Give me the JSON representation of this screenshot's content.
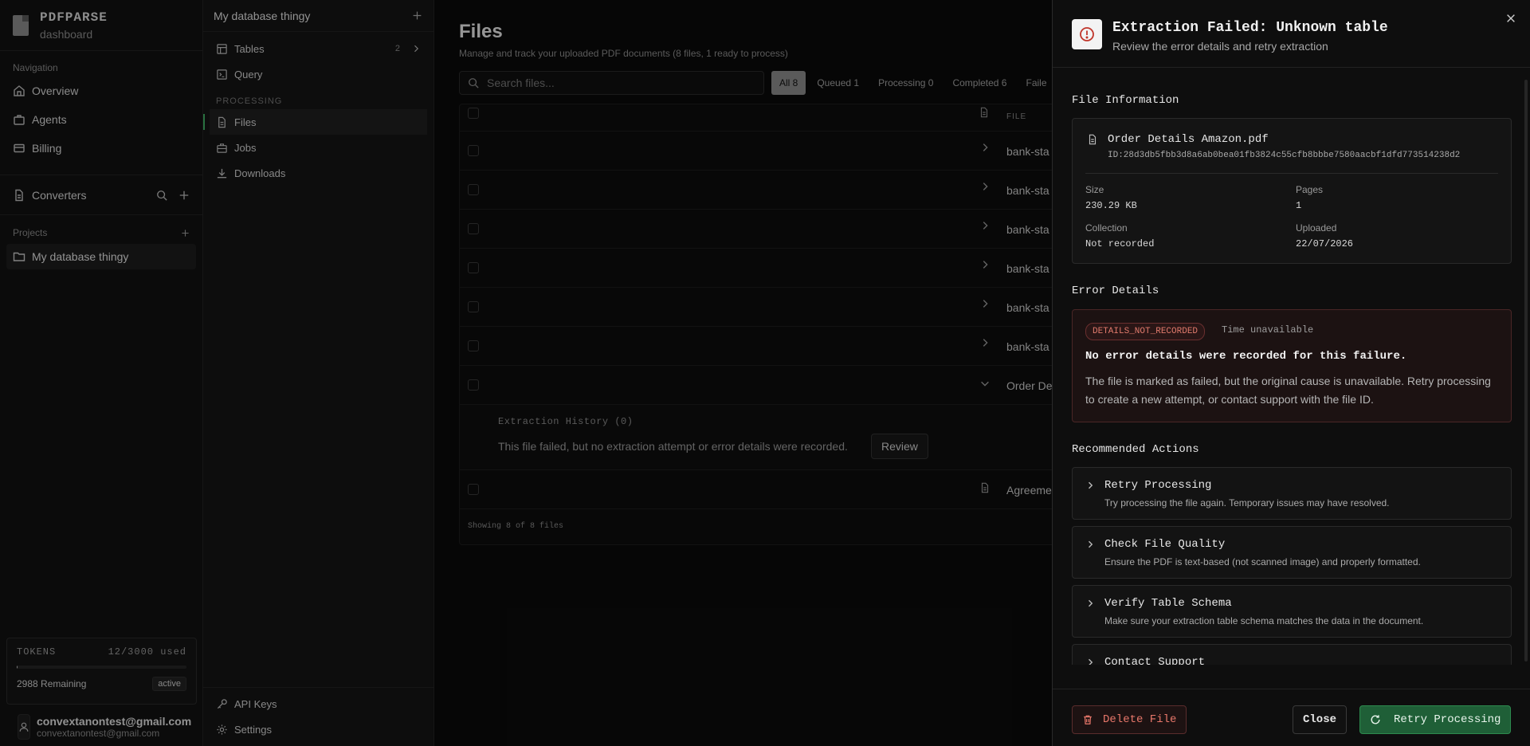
{
  "brand": {
    "name": "PDFPARSE",
    "sub": "dashboard"
  },
  "nav": {
    "label": "Navigation",
    "items": [
      {
        "label": "Overview",
        "icon": "home-icon"
      },
      {
        "label": "Agents",
        "icon": "briefcase-icon"
      },
      {
        "label": "Billing",
        "icon": "card-icon"
      }
    ],
    "converters": "Converters",
    "projects_label": "Projects",
    "project": "My database thingy"
  },
  "tokens": {
    "label": "TOKENS",
    "used": "12/3000 used",
    "used_fraction": 0.004,
    "remaining": "2988 Remaining",
    "status": "active"
  },
  "user": {
    "name": "convextanontest@gmail.com",
    "email": "convextanontest@gmail.com"
  },
  "sidebar2": {
    "title": "My database thingy",
    "tables": "Tables",
    "tables_count": "2",
    "query": "Query",
    "processing_label": "PROCESSING",
    "files": "Files",
    "jobs": "Jobs",
    "downloads": "Downloads",
    "api_keys": "API Keys",
    "settings": "Settings"
  },
  "main": {
    "title": "Files",
    "subtitle": "Manage and track your uploaded PDF documents (8 files, 1 ready to process)",
    "search_placeholder": "Search files...",
    "filters": [
      "All 8",
      "Queued 1",
      "Processing 0",
      "Completed 6",
      "Faile"
    ],
    "col_file": "FILE",
    "rows": [
      "bank-sta",
      "bank-sta",
      "bank-sta",
      "bank-sta",
      "bank-sta",
      "bank-sta",
      "Order De"
    ],
    "expand_title": "Extraction History (0)",
    "expand_text": "This file failed, but no extraction attempt or error details were recorded.",
    "expand_button": "Review",
    "last_row": "Agreeme",
    "footer": "Showing 8 of 8 files"
  },
  "panel": {
    "title": "Extraction Failed: Unknown table",
    "subtitle": "Review the error details and retry extraction",
    "file_info_title": "File Information",
    "file_name": "Order Details Amazon.pdf",
    "file_id": "ID:28d3db5fbb3d8a6ab0bea01fb3824c55cfb8bbbe7580aacbf1dfd773514238d2",
    "size_label": "Size",
    "size": "230.29 KB",
    "pages_label": "Pages",
    "pages": "1",
    "collection_label": "Collection",
    "collection": "Not recorded",
    "uploaded_label": "Uploaded",
    "uploaded": "22/07/2026",
    "error_title": "Error Details",
    "error_code": "DETAILS_NOT_RECORDED",
    "error_time": "Time unavailable",
    "error_main": "No error details were recorded for this failure.",
    "error_desc": "The file is marked as failed, but the original cause is unavailable. Retry processing to create a new attempt, or contact support with the file ID.",
    "actions_title": "Recommended Actions",
    "actions": [
      {
        "title": "Retry Processing",
        "desc": "Try processing the file again. Temporary issues may have resolved."
      },
      {
        "title": "Check File Quality",
        "desc": "Ensure the PDF is text-based (not scanned image) and properly formatted."
      },
      {
        "title": "Verify Table Schema",
        "desc": "Make sure your extraction table schema matches the data in the document."
      },
      {
        "title": "Contact Support",
        "desc": ""
      }
    ],
    "delete": "Delete File",
    "close": "Close",
    "retry": "Retry Processing"
  },
  "colors": {
    "accent_green": "#1f5f37",
    "error_red": "#e8776a"
  }
}
